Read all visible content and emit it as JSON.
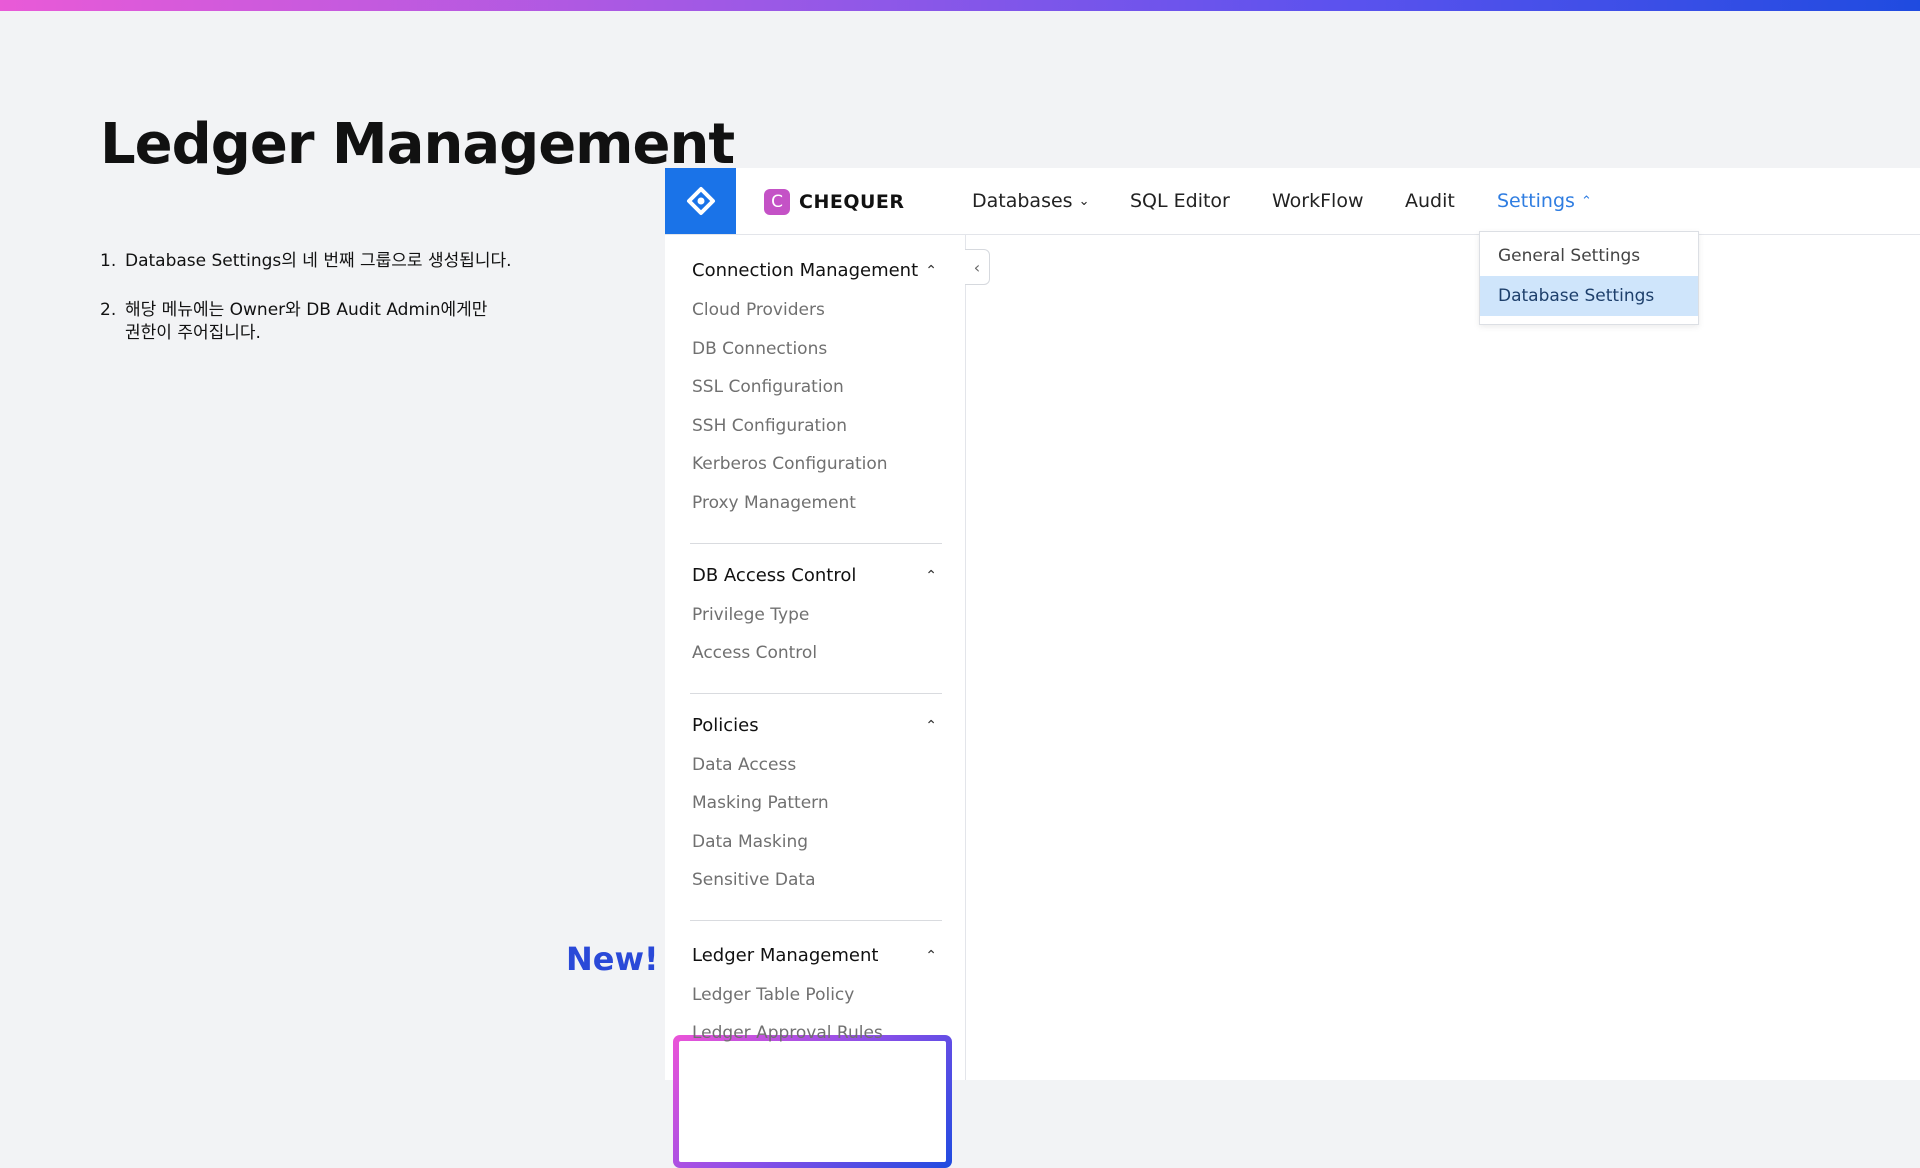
{
  "slide": {
    "title": "Ledger Management",
    "notes": [
      {
        "num": "1.",
        "text": "Database Settings의 네 번째 그룹으로 생성됩니다."
      },
      {
        "num": "2.",
        "text": "해당 메뉴에는 Owner와 DB Audit Admin에게만 권한이 주어집니다."
      }
    ],
    "new_label": "New!"
  },
  "colors": {
    "accent": "#1a73e8",
    "active_nav": "#2f7de1",
    "selected_bg": "#cfe5fb",
    "new_label": "#2a49d8",
    "logo": "#c452c6"
  },
  "app": {
    "brand_icon": "querypie-logo-icon",
    "logo": {
      "mark": "C",
      "name": "CHEQUER"
    },
    "nav": [
      {
        "label": "Databases",
        "chevron": "chevron-down-icon"
      },
      {
        "label": "SQL Editor"
      },
      {
        "label": "WorkFlow"
      },
      {
        "label": "Audit"
      },
      {
        "label": "Settings",
        "chevron": "chevron-up-icon",
        "active": true
      }
    ],
    "settings_dropdown": [
      {
        "label": "General Settings"
      },
      {
        "label": "Database Settings",
        "selected": true
      }
    ],
    "sidebar": {
      "groups": [
        {
          "title": "Connection Management",
          "items": [
            "Cloud Providers",
            "DB Connections",
            "SSL Configuration",
            "SSH Configuration",
            "Kerberos Configuration",
            "Proxy Management"
          ]
        },
        {
          "title": "DB Access Control",
          "items": [
            "Privilege Type",
            "Access Control"
          ]
        },
        {
          "title": "Policies",
          "items": [
            "Data Access",
            "Masking Pattern",
            "Data Masking",
            "Sensitive Data"
          ]
        },
        {
          "title": "Ledger Management",
          "items": [
            "Ledger Table Policy",
            "Ledger Approval Rules"
          ]
        }
      ]
    }
  }
}
